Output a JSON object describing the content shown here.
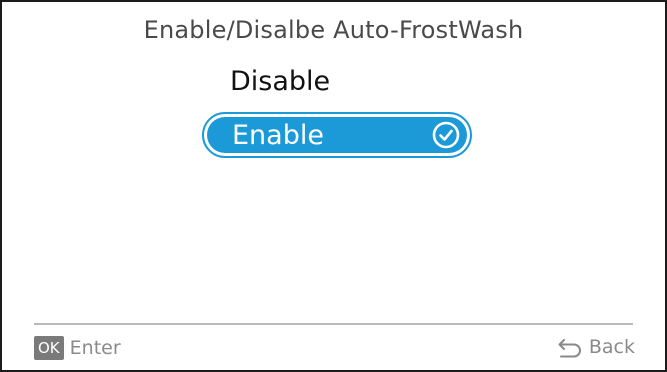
{
  "header": {
    "title": "Enable/Disalbe Auto-FrostWash"
  },
  "options": {
    "items": [
      {
        "label": "Disable",
        "selected": false
      },
      {
        "label": "Enable",
        "selected": true
      }
    ]
  },
  "footer": {
    "ok_badge": "OK",
    "enter_label": "Enter",
    "back_label": "Back"
  },
  "icons": {
    "selected": "check-circle-icon",
    "back": "back-arrow-icon"
  },
  "colors": {
    "accent": "#1c9ad8",
    "text": "#111111",
    "muted": "#8a8a8a",
    "frame": "#1b1b1b"
  }
}
